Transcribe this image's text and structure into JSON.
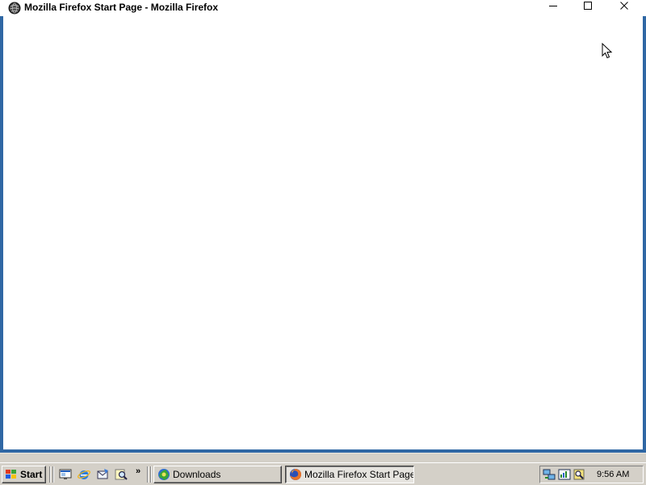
{
  "window": {
    "title": "Mozilla Firefox Start Page - Mozilla Firefox",
    "app_icon": "firefox-globe-icon",
    "controls": {
      "minimize_icon": "minimize-icon",
      "maximize_icon": "maximize-icon",
      "close_icon": "close-icon"
    }
  },
  "taskbar": {
    "start_label": "Start",
    "start_icon": "windows-flag-icon",
    "quick_launch": [
      {
        "icon": "show-desktop-icon"
      },
      {
        "icon": "internet-explorer-icon"
      },
      {
        "icon": "outlook-express-icon"
      },
      {
        "icon": "search-icon"
      }
    ],
    "quick_launch_more": "»",
    "tasks": [
      {
        "label": "Downloads",
        "icon": "firefox-downloads-icon",
        "active": false
      },
      {
        "label": "Mozilla Firefox Start Page...",
        "icon": "firefox-icon",
        "active": true
      }
    ],
    "tray": {
      "icons": [
        "network-icon",
        "volume-icon",
        "security-icon"
      ],
      "clock": "9:56 AM"
    }
  },
  "colors": {
    "desktop_blue": "#3a6ea5",
    "window_frame": "#2f67a4",
    "taskbar_gray": "#d4d0c8"
  }
}
